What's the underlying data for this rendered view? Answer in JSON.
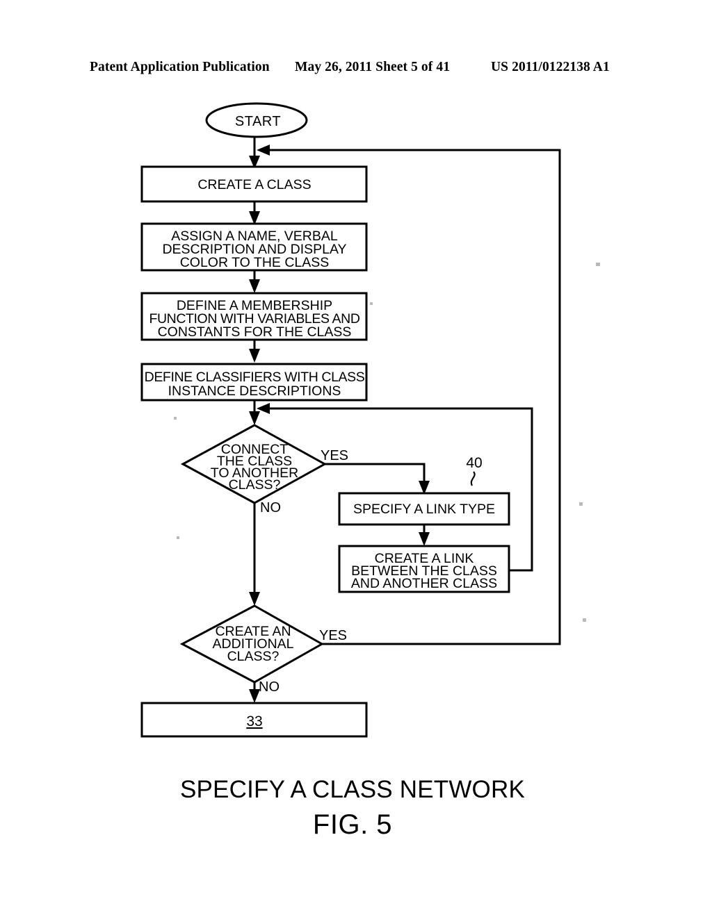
{
  "header": {
    "left": "Patent Application Publication",
    "middle": "May 26, 2011  Sheet 5 of 41",
    "right": "US 2011/0122138 A1"
  },
  "figure": {
    "caption": "SPECIFY A CLASS NETWORK",
    "figure_label": "FIG. 5",
    "reference_numeral": "40",
    "terminator": {
      "label": "START"
    },
    "nodes": [
      {
        "id": "create-a-class",
        "type": "process",
        "lines": [
          "CREATE A CLASS"
        ]
      },
      {
        "id": "assign-name",
        "type": "process",
        "lines": [
          "ASSIGN A NAME, VERBAL",
          "DESCRIPTION AND DISPLAY",
          "COLOR TO THE CLASS"
        ]
      },
      {
        "id": "define-membership-function",
        "type": "process",
        "lines": [
          "DEFINE A MEMBERSHIP",
          "FUNCTION WITH VARIABLES AND",
          "CONSTANTS FOR THE CLASS"
        ]
      },
      {
        "id": "define-classifiers",
        "type": "process",
        "lines": [
          "DEFINE CLASSIFIERS WITH CLASS",
          "INSTANCE DESCRIPTIONS"
        ]
      },
      {
        "id": "connect-class-decision",
        "type": "decision",
        "lines": [
          "CONNECT",
          "THE CLASS",
          "TO ANOTHER",
          "CLASS?"
        ],
        "yes_label": "YES",
        "no_label": "NO"
      },
      {
        "id": "specify-a-link-type",
        "type": "process",
        "lines": [
          "SPECIFY A LINK TYPE"
        ]
      },
      {
        "id": "create-a-link",
        "type": "process",
        "lines": [
          "CREATE A LINK",
          "BETWEEN THE CLASS",
          "AND ANOTHER CLASS"
        ]
      },
      {
        "id": "create-additional-class-decision",
        "type": "decision",
        "lines": [
          "CREATE AN",
          "ADDITIONAL",
          "CLASS?"
        ],
        "yes_label": "YES",
        "no_label": "NO"
      },
      {
        "id": "next-step-box",
        "type": "process",
        "lines": [
          "33"
        ]
      }
    ]
  }
}
